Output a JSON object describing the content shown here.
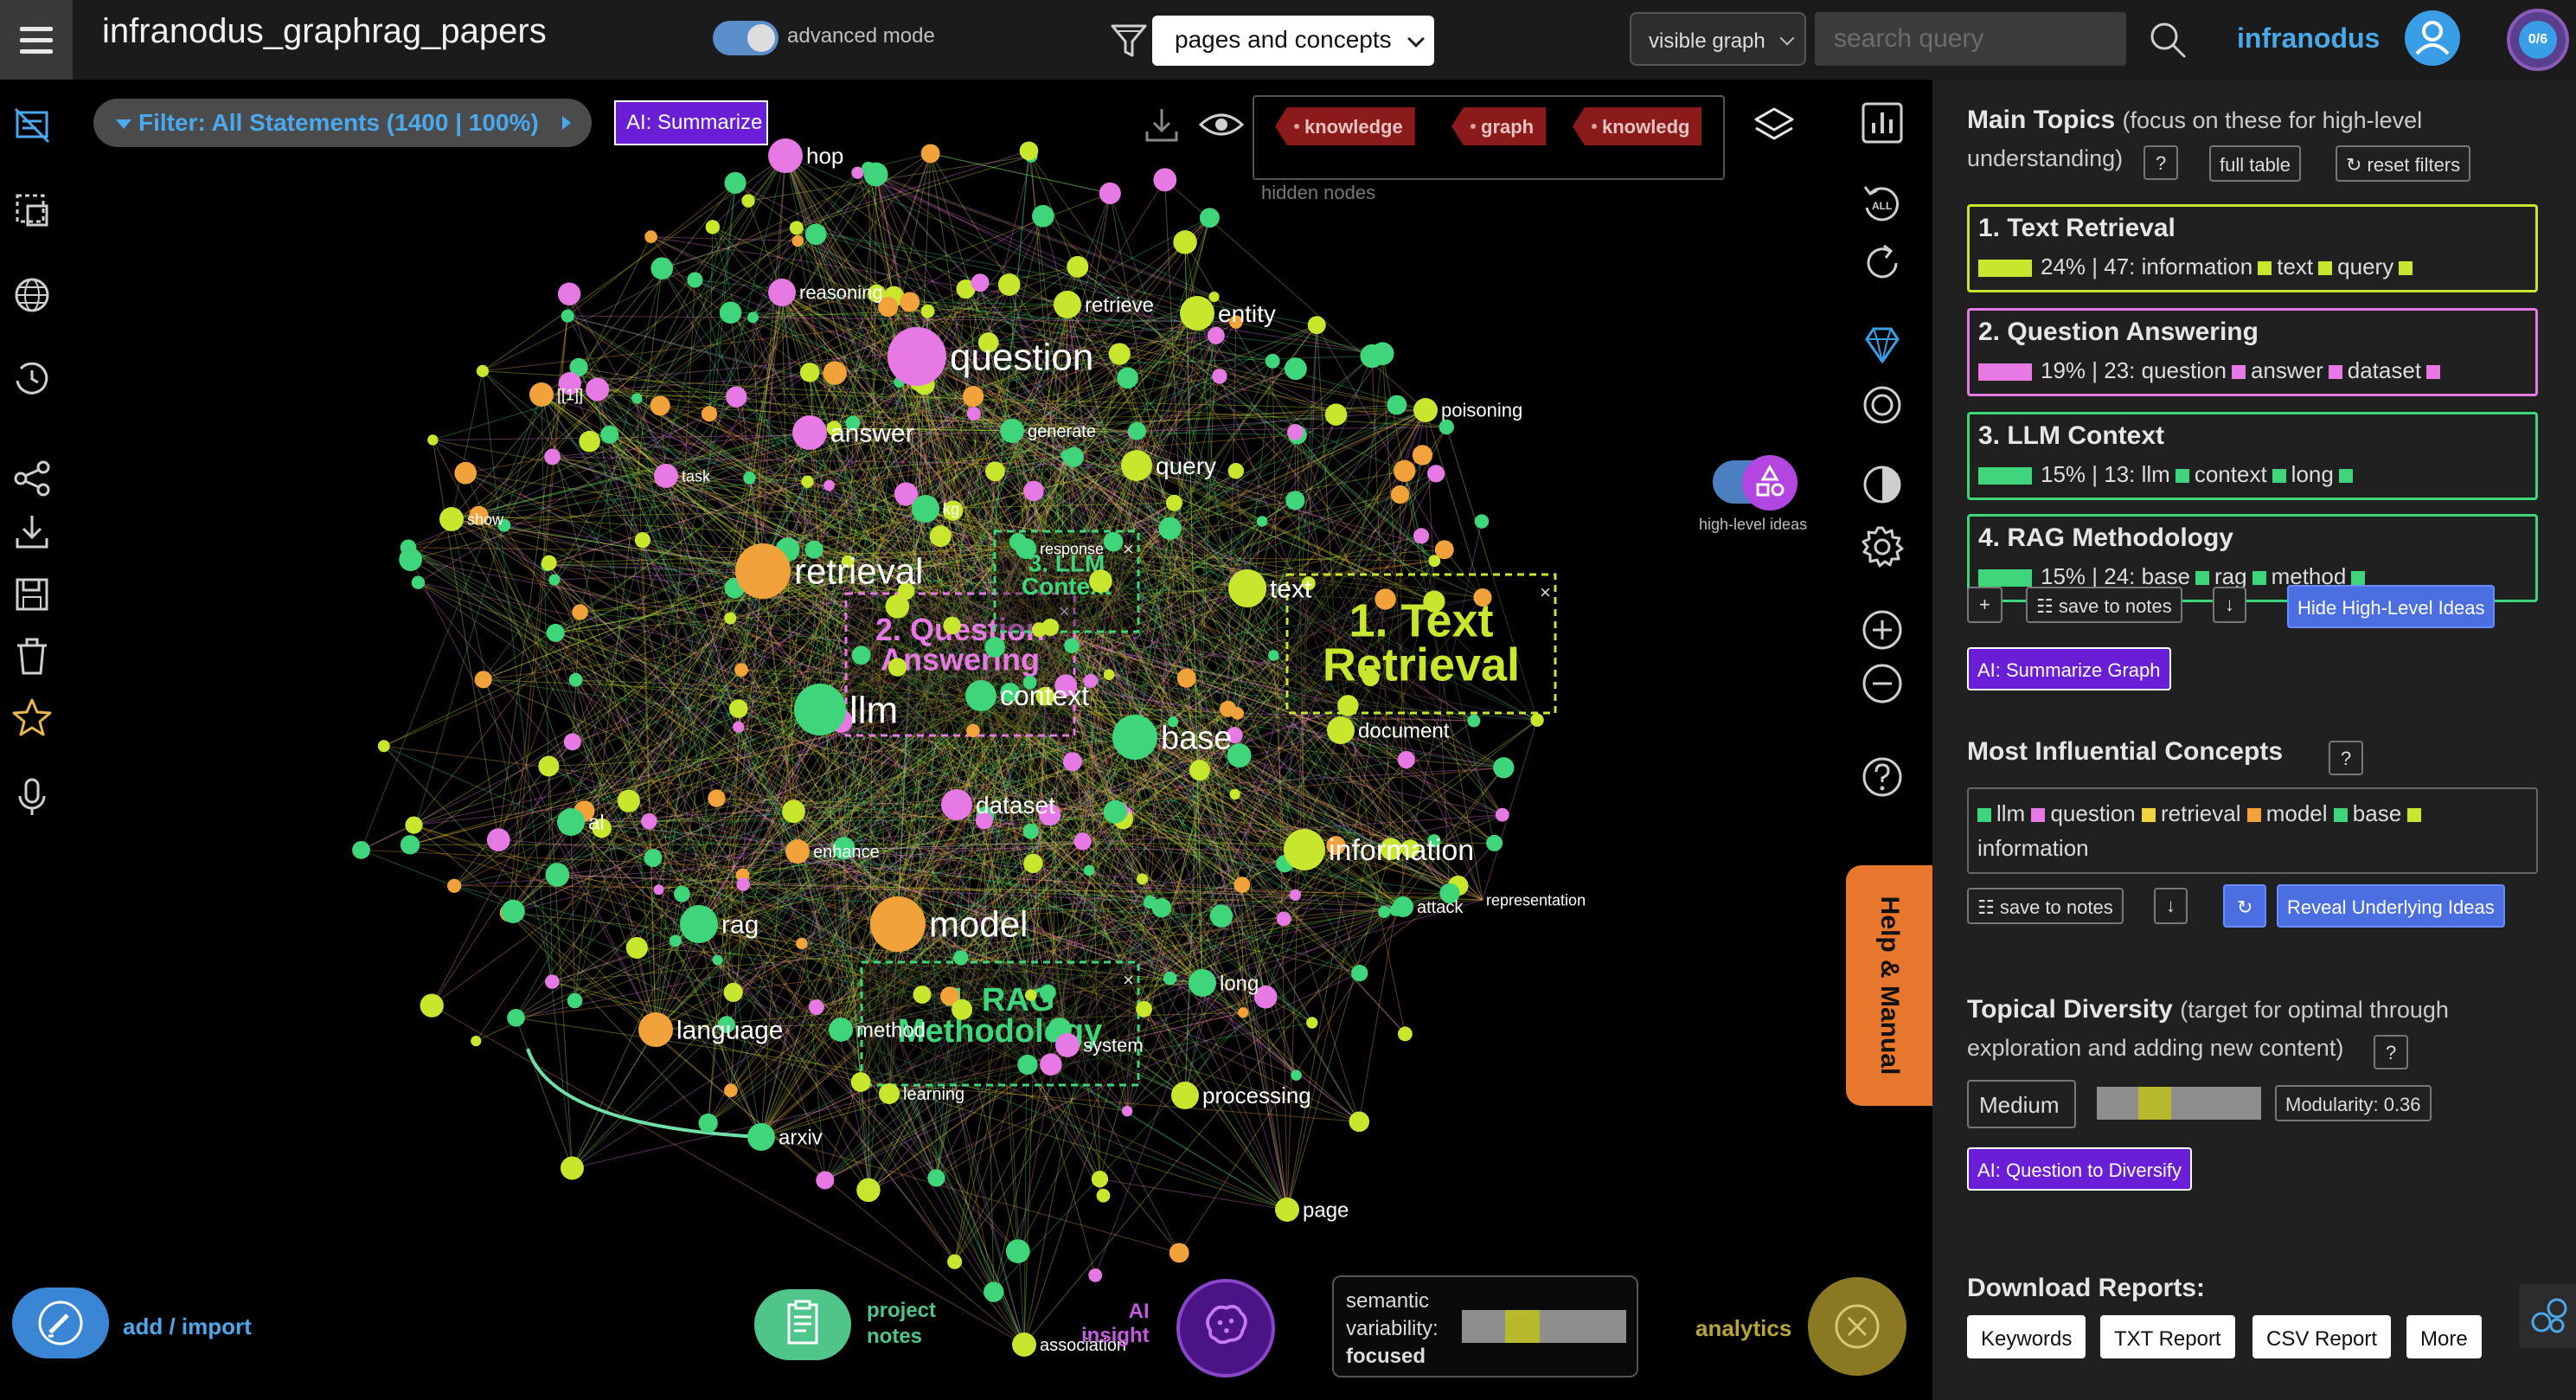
{
  "app": {
    "doc_title": "infranodus_graphrag_papers",
    "advanced_mode_label": "advanced mode",
    "view_mode": "pages and concepts",
    "graph_scope": "visible graph",
    "search_placeholder": "search query",
    "brand": "infranodus",
    "counter": "0/6",
    "accent_color": "#4aa8ef"
  },
  "graph_toolbar": {
    "filter_label": "Filter: All Statements (1400 | 100%)",
    "ai_summarize_label": "AI: Summarize",
    "hidden_nodes": [
      "knowledge",
      "graph",
      "knowledg"
    ],
    "hidden_nodes_label": "hidden nodes",
    "high_level_ideas_label": "high-level ideas"
  },
  "graph": {
    "nodes": [
      {
        "label": "question",
        "cluster": "pink"
      },
      {
        "label": "retrieval",
        "cluster": "orange"
      },
      {
        "label": "llm",
        "cluster": "green"
      },
      {
        "label": "model",
        "cluster": "orange"
      },
      {
        "label": "base",
        "cluster": "green"
      },
      {
        "label": "information",
        "cluster": "yellow"
      },
      {
        "label": "text",
        "cluster": "yellow"
      },
      {
        "label": "context",
        "cluster": "green"
      },
      {
        "label": "answer",
        "cluster": "pink"
      },
      {
        "label": "dataset",
        "cluster": "pink"
      },
      {
        "label": "document",
        "cluster": "yellow"
      },
      {
        "label": "query",
        "cluster": "yellow"
      },
      {
        "label": "entity",
        "cluster": "yellow"
      },
      {
        "label": "retrieve",
        "cluster": "yellow"
      },
      {
        "label": "rag",
        "cluster": "green"
      },
      {
        "label": "language",
        "cluster": "orange"
      },
      {
        "label": "method",
        "cluster": "green"
      },
      {
        "label": "system",
        "cluster": "pink"
      },
      {
        "label": "learning",
        "cluster": "yellow"
      },
      {
        "label": "processing",
        "cluster": "yellow"
      },
      {
        "label": "page",
        "cluster": "yellow"
      },
      {
        "label": "arxiv",
        "cluster": "green"
      },
      {
        "label": "long",
        "cluster": "green"
      },
      {
        "label": "attack",
        "cluster": "green"
      },
      {
        "label": "representation",
        "cluster": "yellow"
      },
      {
        "label": "poisoning",
        "cluster": "yellow"
      },
      {
        "label": "hop",
        "cluster": "pink"
      },
      {
        "label": "reasoning",
        "cluster": "pink"
      },
      {
        "label": "generate",
        "cluster": "green"
      },
      {
        "label": "task",
        "cluster": "pink"
      },
      {
        "label": "show",
        "cluster": "yellow"
      },
      {
        "label": "[[1]]",
        "cluster": "orange"
      },
      {
        "label": "kg",
        "cluster": "green"
      },
      {
        "label": "response",
        "cluster": "green"
      },
      {
        "label": "al",
        "cluster": "green"
      },
      {
        "label": "enhance",
        "cluster": "orange"
      },
      {
        "label": "association",
        "cluster": "yellow"
      }
    ],
    "cluster_labels": [
      "1. Text Retrieval",
      "2. Question Answering",
      "3. LLM Context",
      "4. RAG Methodology"
    ]
  },
  "bottom": {
    "add_label": "add",
    "import_label": "import",
    "notes_label_1": "project",
    "notes_label_2": "notes",
    "ai_label_1": "AI",
    "ai_label_2": "insight",
    "semantic_title_1": "semantic",
    "semantic_title_2": "variability:",
    "semantic_value": "focused",
    "analytics_label": "analytics",
    "help_label": "Help & Manual"
  },
  "panel": {
    "main_topics_title": "Main Topics",
    "main_topics_desc_1": "(focus on these for high-level",
    "main_topics_desc_2": "understanding)",
    "q_mark": "?",
    "full_table": "full table",
    "reset_filters": "↻ reset filters",
    "topics": [
      {
        "title": "1. Text Retrieval",
        "percent": "24%",
        "count": "47",
        "words": [
          "information",
          "text",
          "query"
        ],
        "color": "#c8e62e"
      },
      {
        "title": "2. Question Answering",
        "percent": "19%",
        "count": "23",
        "words": [
          "question",
          "answer",
          "dataset"
        ],
        "color": "#e779e4"
      },
      {
        "title": "3. LLM Context",
        "percent": "15%",
        "count": "13",
        "words": [
          "llm",
          "context",
          "long"
        ],
        "color": "#3fd57b"
      },
      {
        "title": "4. RAG Methodology",
        "percent": "15%",
        "count": "24",
        "words": [
          "base",
          "rag",
          "method"
        ],
        "color": "#3fd57b"
      }
    ],
    "plus": "+",
    "save_to_notes": "save to notes",
    "download_arrow": "↓",
    "hide_hl": "Hide High-Level Ideas",
    "ai_summarize_graph": "AI: Summarize Graph",
    "influential_title": "Most Influential Concepts",
    "influential": [
      {
        "word": "llm",
        "color": "#3fd57b"
      },
      {
        "word": "question",
        "color": "#e779e4"
      },
      {
        "word": "retrieval",
        "color": "#f2d33f"
      },
      {
        "word": "model",
        "color": "#f2a23a"
      },
      {
        "word": "base",
        "color": "#3fd57b"
      },
      {
        "word": "information",
        "color": "#c8e62e"
      }
    ],
    "reveal_btn": "Reveal Underlying Ideas",
    "refresh": "↻",
    "diversity_title": "Topical Diversity",
    "diversity_desc_1": "(target for optimal through",
    "diversity_desc_2": "exploration and adding new content)",
    "diversity_value": "Medium",
    "modularity": "Modularity: 0.36",
    "ai_question": "AI: Question to Diversify",
    "download_title": "Download Reports:",
    "reports": [
      "Keywords",
      "TXT Report",
      "CSV Report",
      "More"
    ]
  }
}
